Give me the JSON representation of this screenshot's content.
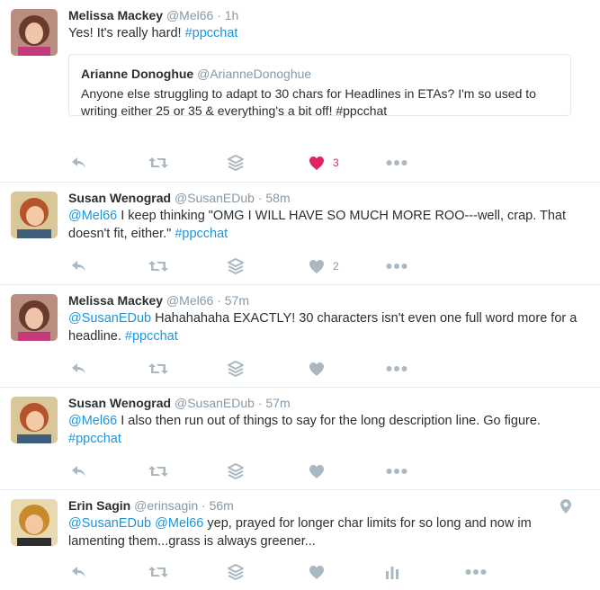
{
  "colors": {
    "link": "#1b95e0",
    "muted": "#8899a6",
    "like_active": "#e0245e",
    "text": "#292f33"
  },
  "tweets": [
    {
      "name": "Melissa Mackey",
      "handle": "@Mel66",
      "dot": "·",
      "time": "1h",
      "text_parts": [
        {
          "t": "Yes! It's really hard! "
        },
        {
          "t": "#ppcchat",
          "link": true
        }
      ],
      "quote": {
        "name": "Arianne Donoghue",
        "handle": "@ArianneDonoghue",
        "text": "Anyone else struggling to adapt to 30 chars for Headlines in ETAs? I'm so used to writing either 25 or 35 & everything's a bit off! #ppcchat"
      },
      "likes": "3",
      "liked": true
    },
    {
      "name": "Susan Wenograd",
      "handle": "@SusanEDub",
      "dot": "·",
      "time": "58m",
      "text_parts": [
        {
          "t": "@Mel66",
          "link": true
        },
        {
          "t": " I keep thinking \"OMG I WILL HAVE SO MUCH MORE ROO---well, crap. That doesn't fit, either.\" "
        },
        {
          "t": "#ppcchat",
          "link": true
        }
      ],
      "likes": "2",
      "liked": false
    },
    {
      "name": "Melissa Mackey",
      "handle": "@Mel66",
      "dot": "·",
      "time": "57m",
      "text_parts": [
        {
          "t": "@SusanEDub",
          "link": true
        },
        {
          "t": " Hahahahaha EXACTLY! 30 characters isn't even one full word more for a headline. "
        },
        {
          "t": "#ppcchat",
          "link": true
        }
      ],
      "likes": "",
      "liked": false
    },
    {
      "name": "Susan Wenograd",
      "handle": "@SusanEDub",
      "dot": "·",
      "time": "57m",
      "text_parts": [
        {
          "t": "@Mel66",
          "link": true
        },
        {
          "t": " I also then run out of things to say for the long description line. Go figure. "
        },
        {
          "t": "#ppcchat",
          "link": true
        }
      ],
      "likes": "",
      "liked": false
    },
    {
      "name": "Erin Sagin",
      "handle": "@erinsagin",
      "dot": "·",
      "time": "56m",
      "text_parts": [
        {
          "t": "@SusanEDub",
          "link": true
        },
        {
          "t": " "
        },
        {
          "t": "@Mel66",
          "link": true
        },
        {
          "t": " yep, prayed for longer char limits for so long and now im lamenting them...grass is always greener..."
        }
      ],
      "likes": "",
      "liked": false,
      "has_geo": true,
      "has_analytics": true
    }
  ]
}
